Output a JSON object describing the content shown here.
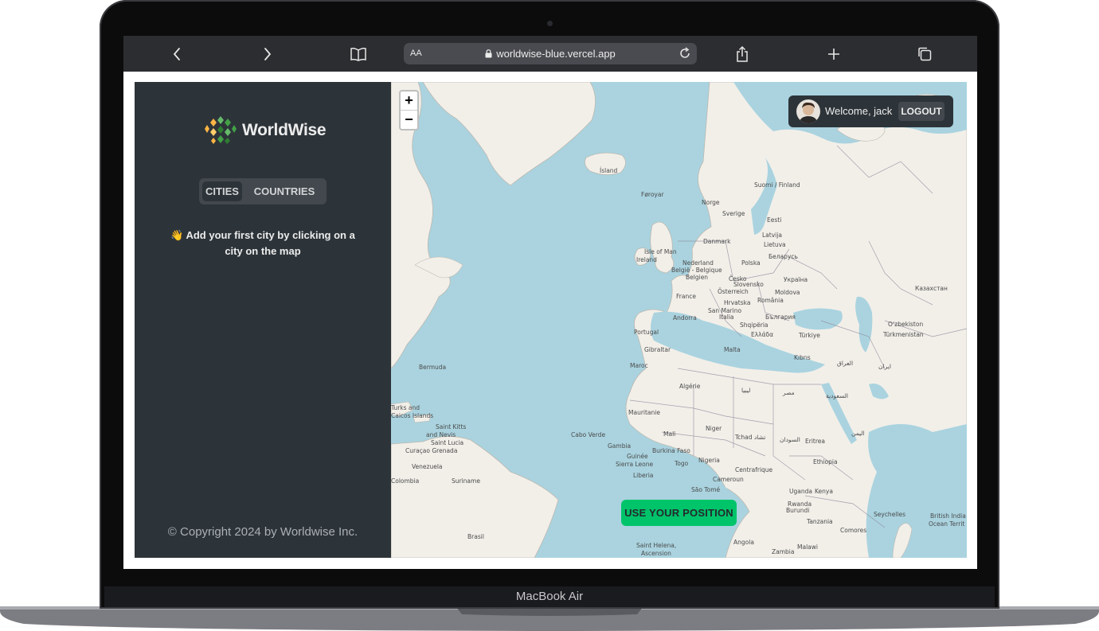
{
  "device": {
    "model_label": "MacBook Air"
  },
  "browser": {
    "text_size_label": "AA",
    "url": "worldwise-blue.vercel.app"
  },
  "sidebar": {
    "logo_text": "WorldWise",
    "tabs": [
      {
        "label": "CITIES",
        "active": true
      },
      {
        "label": "COUNTRIES",
        "active": false
      }
    ],
    "empty_message": "👋 Add your first city by clicking on a city on the map",
    "copyright": "© Copyright 2024 by Worldwise Inc."
  },
  "map": {
    "zoom_in": "+",
    "zoom_out": "−",
    "use_position_label": "USE YOUR POSITION",
    "labels": {
      "island": "Ísland",
      "faroyar": "Føroyar",
      "norge": "Norge",
      "sverige": "Sverige",
      "suomi": "Suomi / Finland",
      "eesti": "Eesti",
      "latvija": "Latvija",
      "lietuva": "Lietuva",
      "danmark": "Danmark",
      "isle_of_man": "Isle of Man",
      "ireland": "Ireland",
      "nederland": "Nederland",
      "belgie": "België - Belgique",
      "belgien": "Belgien",
      "polska": "Polska",
      "belarus": "Беларусь",
      "cesko": "Česko",
      "slovensko": "Slovensko",
      "ukraina": "Україна",
      "osterreich": "Österreich",
      "moldova": "Moldova",
      "hrvatska": "Hrvatska",
      "romania": "România",
      "france": "France",
      "san_marino": "San Marino",
      "bulgaria": "България",
      "andorra": "Andorra",
      "italia": "Italia",
      "shqiperia": "Shqipëria",
      "turkiye": "Türkiye",
      "ellada": "Ελλάδα",
      "portugal": "Portugal",
      "gibraltar": "Gibraltar",
      "malta": "Malta",
      "kibris": "Kıbrıs",
      "maroc": "Maroc",
      "algerie": "Algérie",
      "bermuda": "Bermuda",
      "turks": "Turks and",
      "caicos": "Caicos Islands",
      "saint_kitts": "Saint Kitts",
      "and_nevis": "and Nevis",
      "saint_lucia": "Saint Lucia",
      "curacao": "Curaçao Grenada",
      "venezuela": "Venezuela",
      "colombia": "Colombia",
      "suriname": "Suriname",
      "brasil": "Brasil",
      "mauritanie": "Mauritanie",
      "mali": "Mali",
      "niger": "Niger",
      "tchad": "Tchad تشاد",
      "cabo_verde": "Cabo Verde",
      "gambia": "Gambia",
      "guinee": "Guinée",
      "sierra_leone": "Sierra Leone",
      "liberia": "Liberia",
      "burkina": "Burkina Faso",
      "togo": "Togo",
      "nigeria": "Nigeria",
      "centrafrique": "Centrafrique",
      "cameroun": "Cameroun",
      "sao_tome": "São Tomé",
      "eritrea": "Eritrea",
      "ethiopia": "Ethiopia",
      "uganda": "Uganda",
      "kenya": "Kenya",
      "rwanda": "Rwanda",
      "burundi": "Burundi",
      "tanzania": "Tanzania",
      "comores": "Comores",
      "seychelles": "Seychelles",
      "angola": "Angola",
      "zambia": "Zambia",
      "malawi": "Malawi",
      "saint_helena": "Saint Helena,",
      "ascension": "Ascension",
      "british_indian": "British India",
      "ocean_territory": "Ocean Territ",
      "kazakhstan": "Казахстан",
      "ozbekiston": "Oʻzbekiston",
      "turkmenistan": "Türkmenistan",
      "iran": "ایران",
      "iraq": "العراق",
      "saudi": "السعودية",
      "misr": "مصر",
      "libya": "ليبيا",
      "sudan": "السودان",
      "yemen": "اليمن"
    }
  },
  "user": {
    "welcome": "Welcome, jack",
    "logout_label": "LOGOUT"
  }
}
